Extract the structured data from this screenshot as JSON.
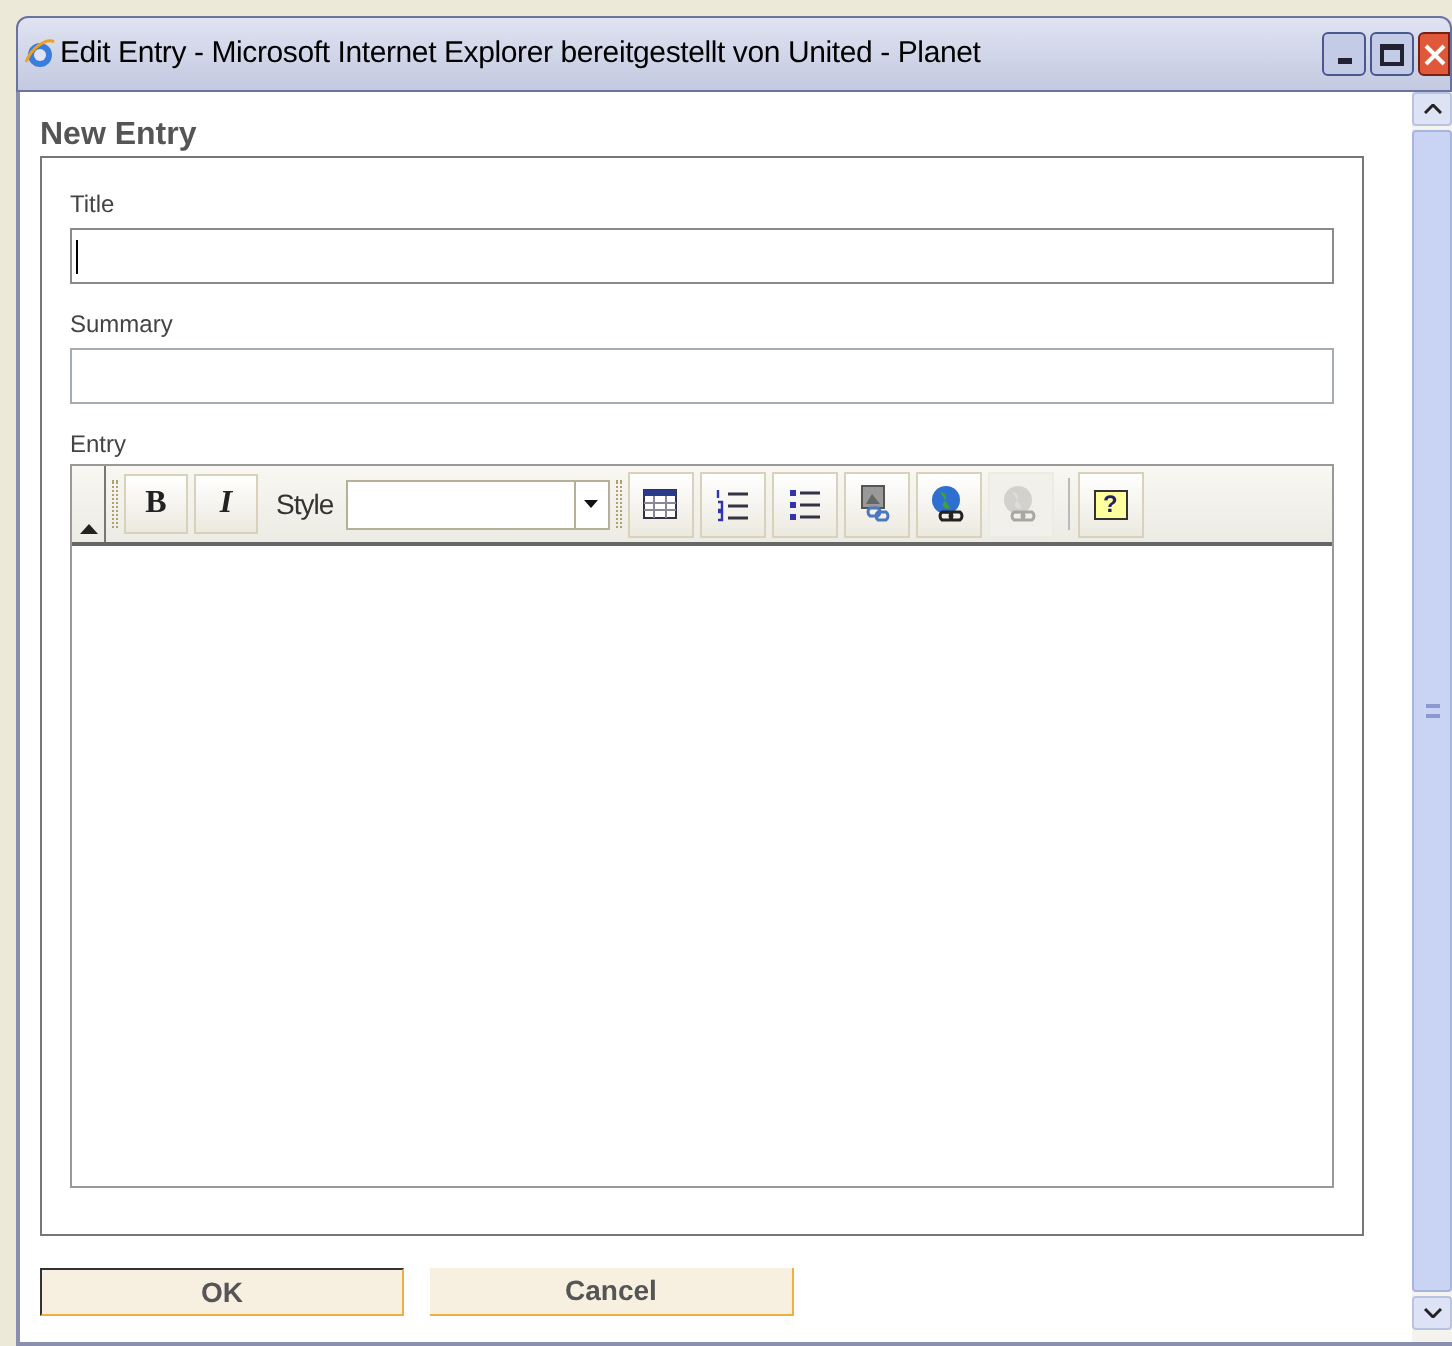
{
  "window": {
    "title": "Edit Entry - Microsoft Internet Explorer bereitgestellt von United - Planet"
  },
  "heading": "New Entry",
  "fields": [
    {
      "label": "Title",
      "focused": true
    },
    {
      "label": "Summary",
      "focused": false
    }
  ],
  "editor": {
    "label": "Entry",
    "toolbar": [
      {
        "kind": "bold",
        "label": "B",
        "disabled": false
      },
      {
        "kind": "italic",
        "label": "I",
        "disabled": false
      },
      {
        "kind": "style",
        "label": "Style"
      },
      {
        "kind": "table",
        "disabled": false
      },
      {
        "kind": "numbered",
        "disabled": false
      },
      {
        "kind": "bulleted",
        "disabled": false
      },
      {
        "kind": "image",
        "disabled": false
      },
      {
        "kind": "link",
        "disabled": false
      },
      {
        "kind": "unlink",
        "disabled": true
      },
      {
        "kind": "help",
        "label": "?",
        "disabled": false
      }
    ]
  },
  "buttons": [
    {
      "label": "OK",
      "default": true
    },
    {
      "label": "Cancel",
      "default": false
    }
  ]
}
